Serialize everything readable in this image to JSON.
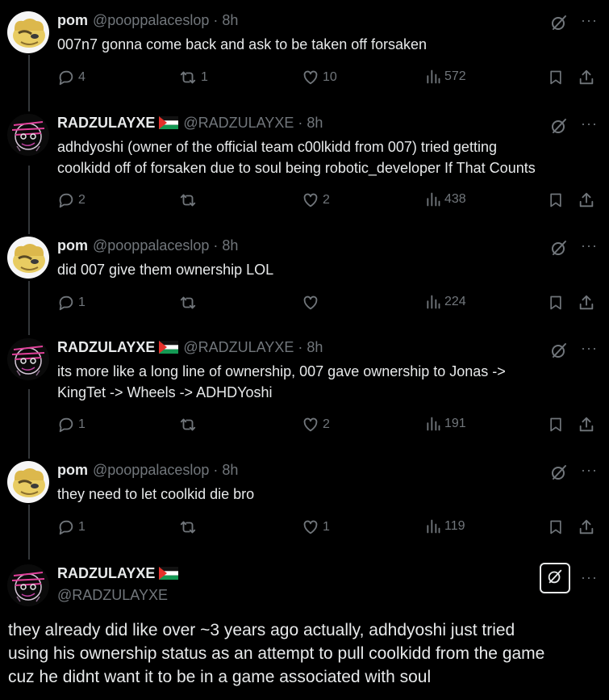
{
  "tweets": [
    {
      "name": "pom",
      "handle": "@pooppalaceslop",
      "time": "8h",
      "text": "007n7 gonna come back and ask to be taken off forsaken",
      "replies": "4",
      "reposts": "1",
      "likes": "10",
      "views": "572"
    },
    {
      "name": "RADZULAYXE",
      "handle": "@RADZULAYXE",
      "time": "8h",
      "text_line1": "adhdyoshi (owner of the official team c00lkidd from 007) tried getting",
      "text_line2": "coolkidd off of forsaken due to soul being robotic_developer If That Counts",
      "replies": "2",
      "reposts": "",
      "likes": "2",
      "views": "438"
    },
    {
      "name": "pom",
      "handle": "@pooppalaceslop",
      "time": "8h",
      "text": "did 007 give them ownership LOL",
      "replies": "1",
      "reposts": "",
      "likes": "",
      "views": "224"
    },
    {
      "name": "RADZULAYXE",
      "handle": "@RADZULAYXE",
      "time": "8h",
      "text_line1": "its more like a long line of ownership, 007 gave ownership to Jonas ->",
      "text_line2": "KingTet -> Wheels -> ADHDYoshi",
      "replies": "1",
      "reposts": "",
      "likes": "2",
      "views": "191"
    },
    {
      "name": "pom",
      "handle": "@pooppalaceslop",
      "time": "8h",
      "text": "they need to let coolkid die bro",
      "replies": "1",
      "reposts": "",
      "likes": "1",
      "views": "119"
    }
  ],
  "main": {
    "name": "RADZULAYXE",
    "handle": "@RADZULAYXE",
    "line1": "they already did like over ~3 years ago actually, adhdyoshi just tried",
    "line2": "using his ownership status as an attempt to pull coolkidd from the game",
    "line3": "cuz he didnt want it to be in a game associated with soul"
  },
  "more_label": "···",
  "dot": "·",
  "colors": {
    "background": "#000000",
    "text": "#e7e9ea",
    "muted": "#71767b",
    "line": "#333639"
  },
  "icons": [
    "reply-icon",
    "repost-icon",
    "like-icon",
    "views-icon",
    "bookmark-icon",
    "share-icon",
    "grok-icon",
    "more-icon",
    "flag-icon"
  ]
}
